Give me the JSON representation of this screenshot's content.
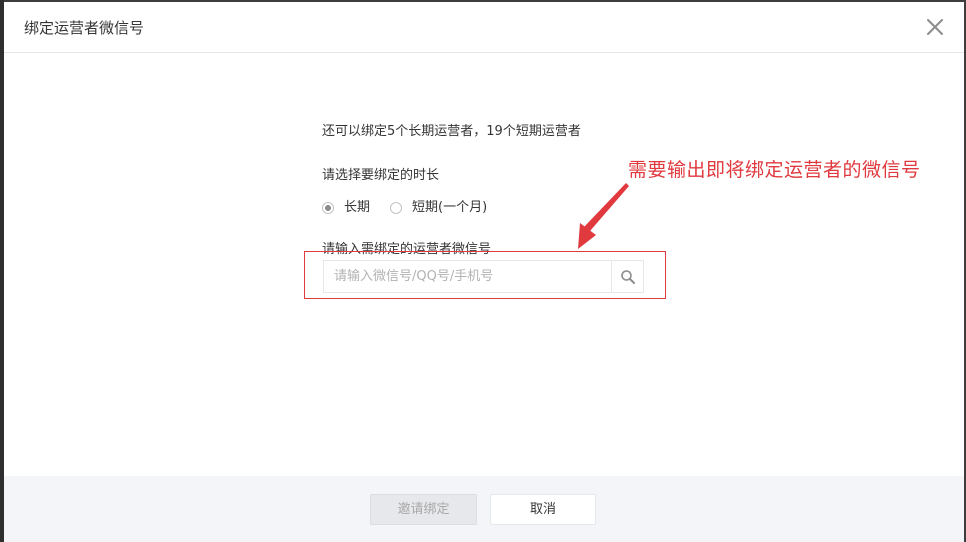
{
  "dialog": {
    "title": "绑定运营者微信号",
    "close_icon": "close-icon"
  },
  "body": {
    "quota_text": "还可以绑定5个长期运营者，19个短期运营者",
    "duration_label": "请选择要绑定的时长",
    "duration_options": [
      {
        "label": "长期",
        "checked": true
      },
      {
        "label": "短期(一个月)",
        "checked": false
      }
    ],
    "input_label": "请输入需绑定的运营者微信号",
    "search": {
      "placeholder": "请输入微信号/QQ号/手机号",
      "value": "",
      "icon": "search-icon"
    },
    "annotation": {
      "text": "需要输出即将绑定运营者的微信号",
      "color": "#e0393e"
    }
  },
  "footer": {
    "invite_label": "邀请绑定",
    "invite_disabled": true,
    "cancel_label": "取消"
  }
}
